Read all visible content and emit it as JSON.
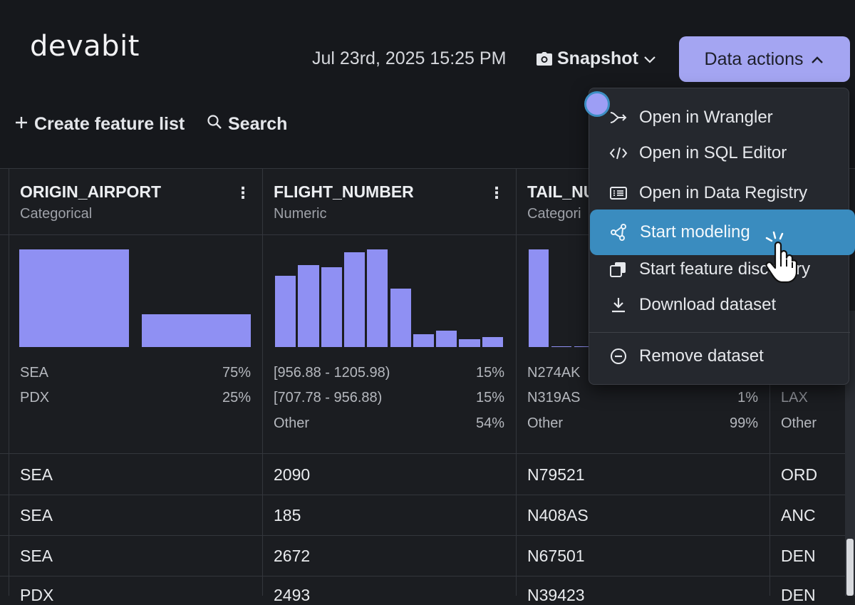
{
  "brand": "devabit",
  "header": {
    "datetime": "Jul 23rd, 2025 15:25 PM",
    "snapshot_label": "Snapshot",
    "data_actions_label": "Data actions"
  },
  "toolbar": {
    "create_feature_list": "Create feature list",
    "search": "Search"
  },
  "columns": [
    {
      "name": "ORIGIN_AIRPORT",
      "type": "Categorical",
      "histogram": [
        75,
        25
      ],
      "stats": [
        {
          "label": "SEA",
          "pct": "75%"
        },
        {
          "label": "PDX",
          "pct": "25%"
        }
      ]
    },
    {
      "name": "FLIGHT_NUMBER",
      "type": "Numeric",
      "histogram": [
        73,
        84,
        82,
        97,
        100,
        60,
        13,
        17,
        8,
        10
      ],
      "stats": [
        {
          "label": "[956.88 - 1205.98)",
          "pct": "15%"
        },
        {
          "label": "[707.78 - 956.88)",
          "pct": "15%"
        },
        {
          "label": "Other",
          "pct": "54%"
        }
      ]
    },
    {
      "name": "TAIL_NU",
      "type": "Categori",
      "histogram": [
        100,
        1,
        1
      ],
      "stats": [
        {
          "label": "N274AK",
          "pct": ""
        },
        {
          "label": "N319AS",
          "pct": "1%"
        },
        {
          "label": "Other",
          "pct": "99%"
        }
      ]
    },
    {
      "name": "",
      "type": "",
      "stats": [
        {
          "label": "",
          "pct": ""
        },
        {
          "label": "LAX",
          "pct": ""
        },
        {
          "label": "Other",
          "pct": ""
        }
      ]
    }
  ],
  "rows": [
    [
      "SEA",
      "2090",
      "N79521",
      "ORD"
    ],
    [
      "SEA",
      "185",
      "N408AS",
      "ANC"
    ],
    [
      "SEA",
      "2672",
      "N67501",
      "DEN"
    ],
    [
      "PDX",
      "2493",
      "N39423",
      "DEN"
    ]
  ],
  "menu": {
    "items": [
      {
        "label": "Open in Wrangler",
        "icon": "wrangler-icon"
      },
      {
        "label": "Open in SQL Editor",
        "icon": "code-icon"
      },
      {
        "label": "Open in Data Registry",
        "icon": "registry-icon"
      },
      {
        "label": "Start modeling",
        "icon": "modeling-icon"
      },
      {
        "label": "Start feature discovery",
        "icon": "copy-icon"
      },
      {
        "label": "Download dataset",
        "icon": "download-icon"
      },
      {
        "label": "Remove dataset",
        "icon": "remove-icon"
      }
    ]
  },
  "colors": {
    "accent": "#a4a5f2",
    "bar": "#8f90f3",
    "menu_active": "#3a8cbf",
    "background": "#1b1d21"
  }
}
